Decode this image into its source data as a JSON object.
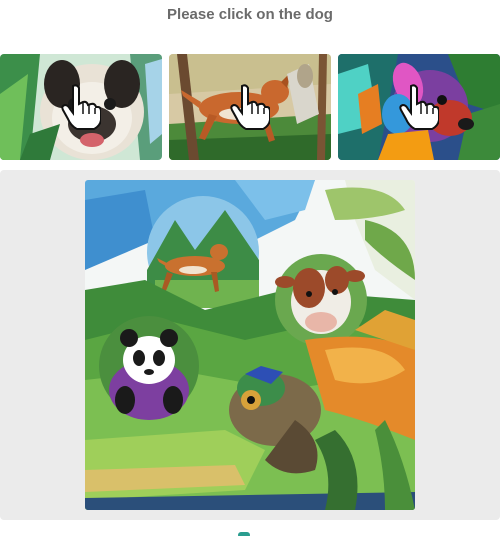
{
  "prompt": {
    "text": "Please click on the dog"
  },
  "examples": [
    {
      "name": "example-pug",
      "subject": "pug",
      "icon": "hand-pointer-icon"
    },
    {
      "name": "example-running-dog",
      "subject": "running-dog",
      "icon": "hand-pointer-icon"
    },
    {
      "name": "example-colorful-dog",
      "subject": "colorful-dog",
      "icon": "hand-pointer-icon"
    }
  ],
  "challenge": {
    "scene": "watercolor jungle with dog, cow, panda and chameleon",
    "animals": [
      "dog",
      "cow",
      "panda",
      "chameleon"
    ]
  },
  "footer": {
    "text": ""
  },
  "colors": {
    "prompt_text": "#6b6b6b",
    "panel_bg": "#ebebeb",
    "accent": "#2a9d8f"
  }
}
